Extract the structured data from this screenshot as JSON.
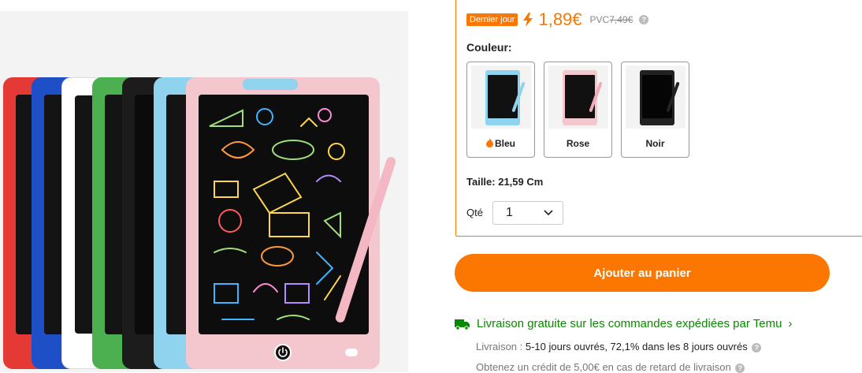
{
  "price": {
    "badge": "Dernier jour",
    "current": "1,89€",
    "pvc_label": "PVC",
    "pvc_value": "7,49€",
    "accent": "#fb7701"
  },
  "color": {
    "label": "Couleur:",
    "options": [
      {
        "name": "Bleu",
        "frame": "#8fd3ee",
        "pen": "#8fd3ee",
        "hot": true
      },
      {
        "name": "Rose",
        "frame": "#f4c7cf",
        "pen": "#f4a9b8",
        "hot": false
      },
      {
        "name": "Noir",
        "frame": "#222222",
        "pen": "#222222",
        "hot": false
      }
    ]
  },
  "size": {
    "label": "Taille: 21,59 Cm"
  },
  "quantity": {
    "label": "Qté",
    "value": "1"
  },
  "cart": {
    "label": "Ajouter au panier"
  },
  "shipping": {
    "headline": "Livraison gratuite sur les commandes expédiées par Temu",
    "delivery_prefix": "Livraison :",
    "delivery_detail": "5-10 jours ouvrés, 72,1% dans les 8 jours ouvrés",
    "credit": "Obtenez un crédit de 5,00€ en cas de retard de livraison",
    "color": "#0a8800"
  },
  "gallery": {
    "tablet_colors": [
      "#e53935",
      "#1e4fc7",
      "#ffffff",
      "#4caf50",
      "#1c1c1c",
      "#8fd3ee",
      "#f4c7cf"
    ]
  }
}
